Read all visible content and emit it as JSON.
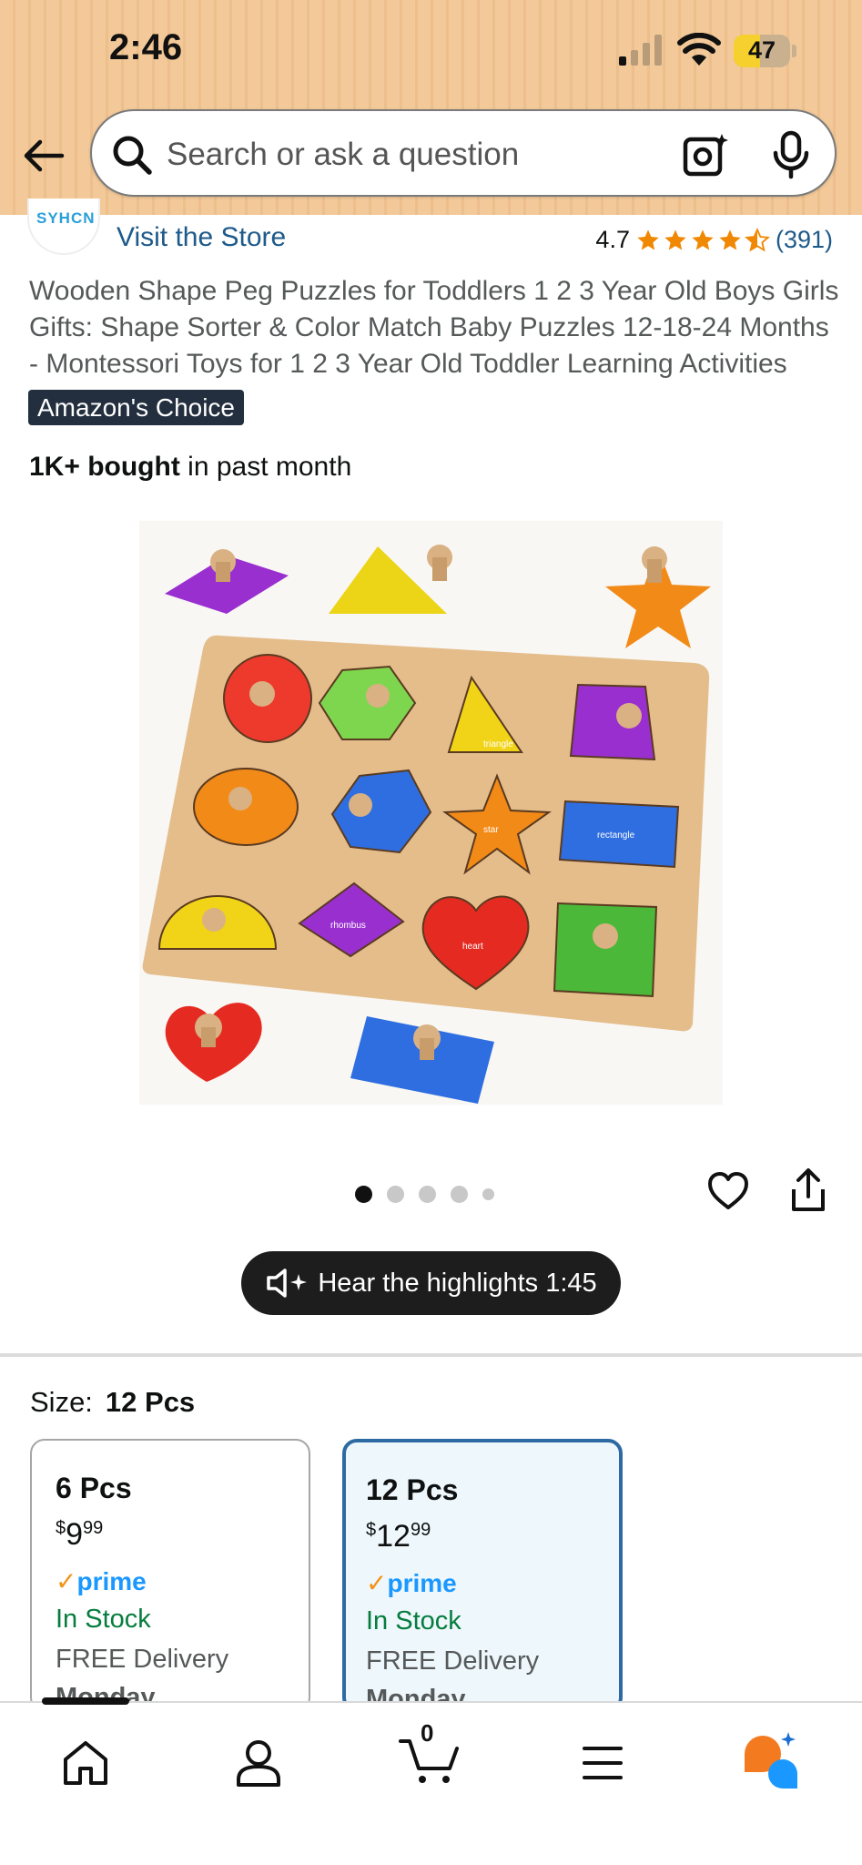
{
  "status_bar": {
    "time": "2:46",
    "battery": "47",
    "battery_level": 0.47
  },
  "search": {
    "placeholder": "Search or ask a question"
  },
  "store": {
    "logo_text": "SYHCN",
    "visit_label": "Visit the Store",
    "rating": "4.7",
    "rating_stars": 4.5,
    "rating_count": "(391)"
  },
  "product": {
    "title": "Wooden Shape Peg Puzzles for Toddlers 1 2 3 Year Old Boys Girls Gifts: Shape Sorter & Color Match Baby Puzzles 12-18-24 Months - Montessori Toys for 1 2 3 Year Old Toddler Learning Activities",
    "badge": "Amazon's Choice",
    "bought_bold": "1K+ bought",
    "bought_rest": " in past month",
    "image_labels": {
      "triangle": "triangle",
      "star": "star",
      "rectangle": "rectangle",
      "rhombus": "rhombus",
      "heart": "heart"
    },
    "image_index": 1,
    "image_count": 5
  },
  "highlights": {
    "label": "Hear the highlights 1:45"
  },
  "size": {
    "label": "Size:",
    "selected": "12 Pcs",
    "options": [
      {
        "name": "6 Pcs",
        "currency": "$",
        "dollars": "9",
        "cents": "99",
        "prime": "prime",
        "stock": "In Stock",
        "delivery": "FREE Delivery",
        "day": "Monday"
      },
      {
        "name": "12 Pcs",
        "currency": "$",
        "dollars": "12",
        "cents": "99",
        "prime": "prime",
        "stock": "In Stock",
        "delivery": "FREE Delivery",
        "day": "Monday"
      }
    ]
  },
  "nav": {
    "cart_count": "0",
    "items": [
      "home-icon",
      "account-icon",
      "cart-icon",
      "menu-icon",
      "rufus-icon"
    ]
  },
  "colors": {
    "accent_blue": "#2d6aa3",
    "link": "#1e5a8a",
    "stock_green": "#067d3e",
    "prime_blue": "#1a98ff",
    "star_orange": "#f08804"
  }
}
